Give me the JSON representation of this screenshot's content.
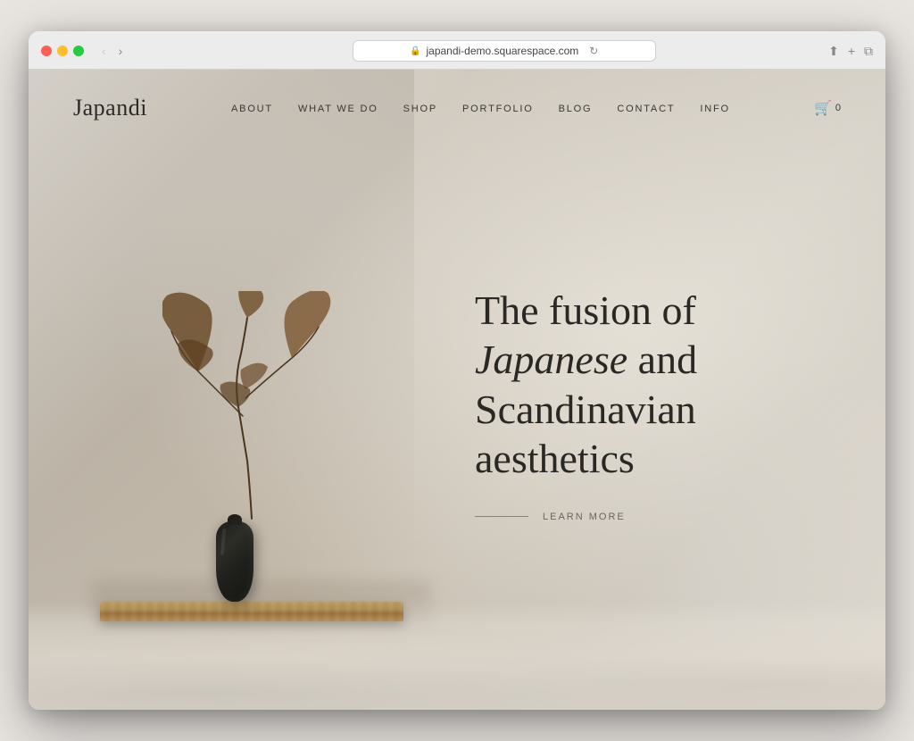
{
  "browser": {
    "url": "japandi-demo.squarespace.com",
    "reload_label": "↻"
  },
  "site": {
    "logo": "Japandi",
    "nav": {
      "items": [
        {
          "label": "ABOUT",
          "href": "#"
        },
        {
          "label": "WHAT WE DO",
          "href": "#"
        },
        {
          "label": "SHOP",
          "href": "#"
        },
        {
          "label": "PORTFOLIO",
          "href": "#"
        },
        {
          "label": "BLOG",
          "href": "#"
        },
        {
          "label": "CONTACT",
          "href": "#"
        },
        {
          "label": "INFO",
          "href": "#"
        }
      ]
    },
    "cart": {
      "count": "0"
    },
    "hero": {
      "heading_part1": "The fusion of ",
      "heading_italic": "Japanese",
      "heading_part2": " and Scandinavian aesthetics",
      "cta_label": "LEARN MORE"
    }
  }
}
